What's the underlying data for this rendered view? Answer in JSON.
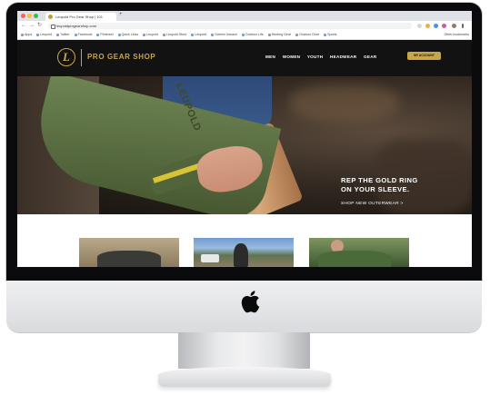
{
  "browser": {
    "tab_title": "Leupold Pro Gear Shop | 101",
    "new_tab": "+",
    "url": "leupoldprogearshop.com",
    "bookmarks": [
      "Apps",
      "Leupold",
      "Twitter",
      "Facebook",
      "Pinterest",
      "Quick Links",
      "Leupold",
      "Leupold Store",
      "Leupold",
      "Garmin Inreach",
      "Outdoor Life",
      "Hunting Gear",
      "Outdoor Gear",
      "Sports"
    ],
    "other_bookmarks": "Other bookmarks"
  },
  "site": {
    "brand": "PRO GEAR SHOP",
    "logo_letter": "L",
    "nav": [
      "MEN",
      "WOMEN",
      "YOUTH",
      "HEADWEAR",
      "GEAR"
    ],
    "cta": "MY ACCOUNT",
    "colors": {
      "gold": "#c9a64a",
      "header_bg": "#121212"
    }
  },
  "hero": {
    "sleeve_print": "LEUPOLD",
    "headline": "REP THE GOLD RING\nON YOUR SLEEVE.",
    "link": "SHOP NEW OUTERWEAR >"
  }
}
